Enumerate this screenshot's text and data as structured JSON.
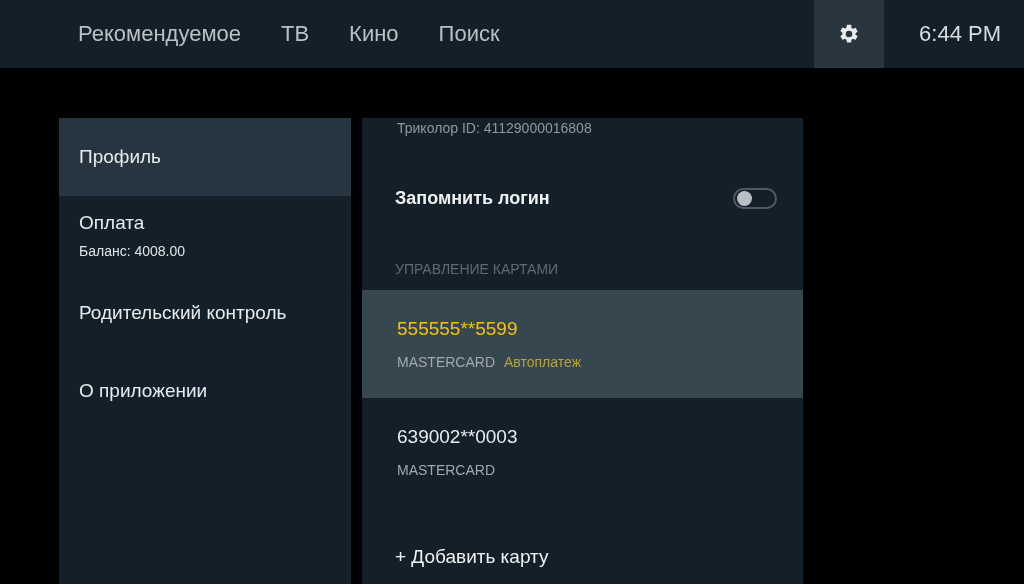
{
  "nav": {
    "tabs": [
      {
        "label": "Рекомендуемое",
        "selected": false
      },
      {
        "label": "ТВ",
        "selected": false
      },
      {
        "label": "Кино",
        "selected": false
      },
      {
        "label": "Поиск",
        "selected": false
      }
    ],
    "settings_selected": true,
    "time": "6:44 PM"
  },
  "sidebar": {
    "items": [
      {
        "label": "Профиль",
        "selected": true
      },
      {
        "label": "Оплата",
        "sublabel": "Баланс: 4008.00",
        "selected": false
      },
      {
        "label": "Родительский контроль",
        "selected": false
      },
      {
        "label": "О приложении",
        "selected": false
      }
    ]
  },
  "profile": {
    "id_line": "Триколор ID: 41129000016808",
    "remember_login": {
      "label": "Запомнить логин",
      "on": false
    },
    "cards_heading": "УПРАВЛЕНИЕ КАРТАМИ",
    "cards": [
      {
        "number": "555555**5599",
        "type": "MASTERCARD",
        "autopay": "Автоплатеж",
        "selected": true
      },
      {
        "number": "639002**0003",
        "type": "MASTERCARD",
        "selected": false
      }
    ],
    "add_card": "+ Добавить карту"
  }
}
